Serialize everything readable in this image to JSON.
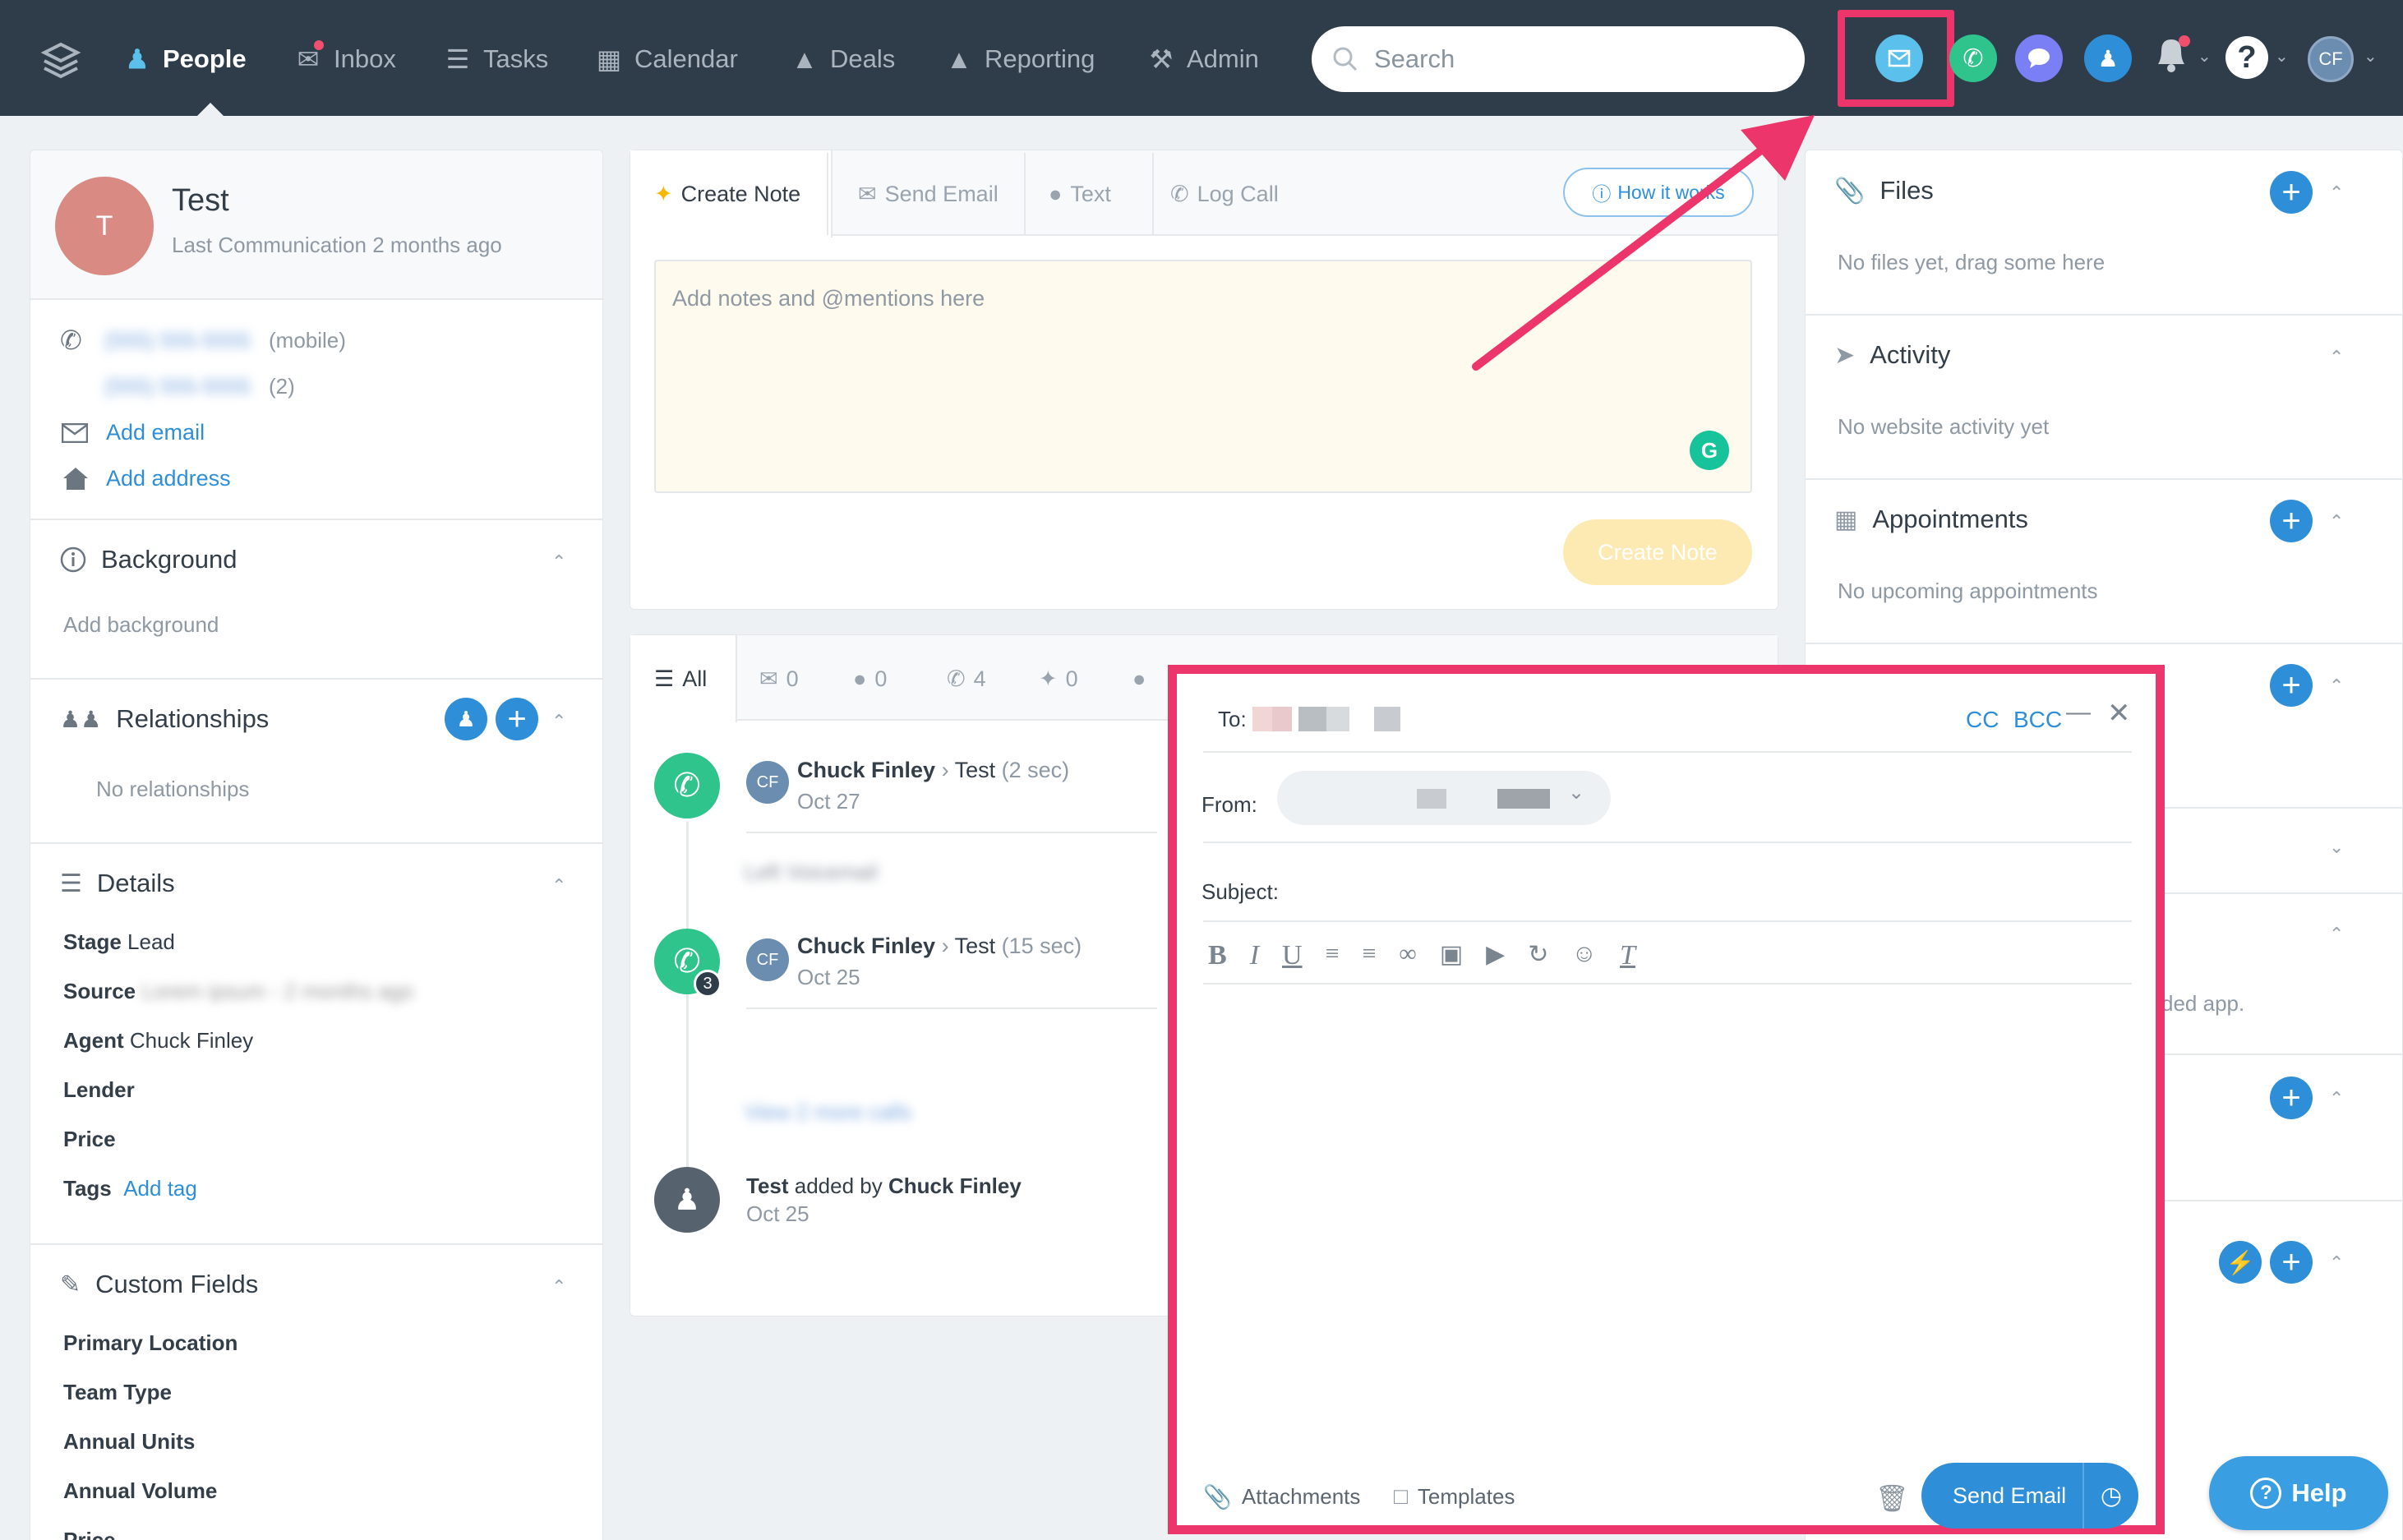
{
  "nav": {
    "items": [
      {
        "label": "People",
        "active": true,
        "icon": "people-icon"
      },
      {
        "label": "Inbox",
        "active": false,
        "icon": "inbox-icon"
      },
      {
        "label": "Tasks",
        "active": false,
        "icon": "tasks-icon"
      },
      {
        "label": "Calendar",
        "active": false,
        "icon": "calendar-icon"
      },
      {
        "label": "Deals",
        "active": false,
        "icon": "deals-icon"
      },
      {
        "label": "Reporting",
        "active": false,
        "icon": "reporting-icon"
      },
      {
        "label": "Admin",
        "active": false,
        "icon": "admin-icon"
      }
    ],
    "search_placeholder": "Search",
    "user_initials": "CF",
    "colors": {
      "bar": "#2f3d4a",
      "highlight": "#ec356b",
      "email_btn": "#5bc0eb",
      "call_btn": "#2fc48b",
      "text_btn": "#7b7ff5",
      "person_btn": "#2e8fd8"
    }
  },
  "contact": {
    "avatar_initial": "T",
    "name": "Test",
    "last_comm": "Last Communication 2 months ago",
    "phone1": "(555) 555-5555",
    "phone1_type": "(mobile)",
    "phone2": "(555) 555-5555",
    "phone2_type": "(2)",
    "add_email": "Add email",
    "add_address": "Add address"
  },
  "background": {
    "title": "Background",
    "placeholder": "Add background"
  },
  "relationships": {
    "title": "Relationships",
    "empty": "No relationships"
  },
  "details": {
    "title": "Details",
    "stage_label": "Stage",
    "stage_value": "Lead",
    "source_label": "Source",
    "source_value": "Lorem ipsum - 2 months ago",
    "agent_label": "Agent",
    "agent_value": "Chuck Finley",
    "lender_label": "Lender",
    "price_label": "Price",
    "tags_label": "Tags",
    "tags_value": "Add tag"
  },
  "custom_fields": {
    "title": "Custom Fields",
    "fields": [
      "Primary Location",
      "Team Type",
      "Annual Units",
      "Annual Volume",
      "Price"
    ]
  },
  "composer": {
    "tabs": [
      "Create Note",
      "Send Email",
      "Text",
      "Log Call"
    ],
    "how_it_works": "How it works",
    "placeholder": "Add notes and @mentions here",
    "submit": "Create Note"
  },
  "timeline": {
    "filters": [
      {
        "label": "All"
      },
      {
        "label": "0"
      },
      {
        "label": "0"
      },
      {
        "label": "4"
      },
      {
        "label": "0"
      }
    ],
    "events": [
      {
        "initials": "CF",
        "agent": "Chuck Finley",
        "target": "Test",
        "duration": "(2 sec)",
        "date": "Oct 27",
        "note": "Left Voicemail"
      },
      {
        "initials": "CF",
        "agent": "Chuck Finley",
        "target": "Test",
        "duration": "(15 sec)",
        "date": "Oct 25",
        "badge": "3",
        "more": "View 2 more calls"
      }
    ],
    "added": {
      "subject": "Test",
      "text": "added by",
      "agent": "Chuck Finley",
      "date": "Oct 25"
    }
  },
  "right": {
    "files": {
      "title": "Files",
      "empty": "No files yet, drag some here"
    },
    "activity": {
      "title": "Activity",
      "empty": "No website activity yet"
    },
    "appointments": {
      "title": "Appointments",
      "empty": "No upcoming appointments"
    },
    "partial_text": "ded app."
  },
  "email": {
    "to_label": "To:",
    "cc": "CC",
    "bcc": "BCC",
    "from_label": "From:",
    "subject_label": "Subject:",
    "toolbar": [
      "bold",
      "italic",
      "underline",
      "bullet-list",
      "numbered-list",
      "link",
      "image",
      "video",
      "undo",
      "emoji",
      "clear-format"
    ],
    "attachments": "Attachments",
    "templates": "Templates",
    "send": "Send Email"
  },
  "help": {
    "label": "Help"
  }
}
